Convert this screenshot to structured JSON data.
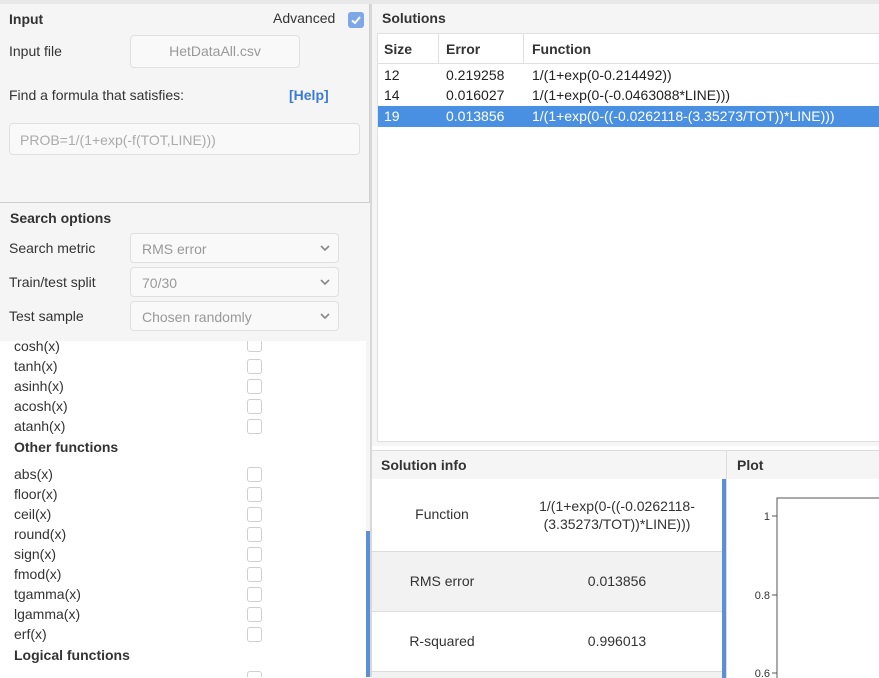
{
  "input": {
    "title": "Input",
    "advanced_label": "Advanced",
    "file_label": "Input file",
    "file_value": "HetDataAll.csv",
    "find_label": "Find a formula that satisfies:",
    "help_label": "[Help]",
    "formula_placeholder": "PROB=1/(1+exp(-f(TOT,LINE)))"
  },
  "search": {
    "title": "Search options",
    "metric_label": "Search metric",
    "metric_value": "RMS error",
    "split_label": "Train/test split",
    "split_value": "70/30",
    "sample_label": "Test sample",
    "sample_value": "Chosen randomly"
  },
  "functions": {
    "hyperbolic": [
      "cosh(x)",
      "tanh(x)",
      "asinh(x)",
      "acosh(x)",
      "atanh(x)"
    ],
    "other_heading": "Other functions",
    "other": [
      "abs(x)",
      "floor(x)",
      "ceil(x)",
      "round(x)",
      "sign(x)",
      "fmod(x)",
      "tgamma(x)",
      "lgamma(x)",
      "erf(x)"
    ],
    "logical_heading": "Logical functions"
  },
  "solutions": {
    "title": "Solutions",
    "headers": [
      "Size",
      "Error",
      "Function"
    ],
    "rows": [
      {
        "size": "12",
        "error": "0.219258",
        "function": "1/(1+exp(0-0.214492))"
      },
      {
        "size": "14",
        "error": "0.016027",
        "function": "1/(1+exp(0-(-0.0463088*LINE)))"
      },
      {
        "size": "19",
        "error": "0.013856",
        "function": "1/(1+exp(0-((-0.0262118-(3.35273/TOT))*LINE)))"
      }
    ],
    "selected_index": 2
  },
  "info": {
    "title": "Solution info",
    "function_label": "Function",
    "function_line1": "1/(1+exp(0-((-0.0262118-",
    "function_line2": "(3.35273/TOT))*LINE)))",
    "rms_label": "RMS error",
    "rms_value": "0.013856",
    "r2_label": "R-squared",
    "r2_value": "0.996013"
  },
  "plot": {
    "title": "Plot",
    "ticks": [
      "1",
      "0.8",
      "0.6"
    ]
  },
  "colors": {
    "selection": "#4a90e2",
    "accent": "#5b8fd8",
    "help": "#3a7bd5"
  }
}
